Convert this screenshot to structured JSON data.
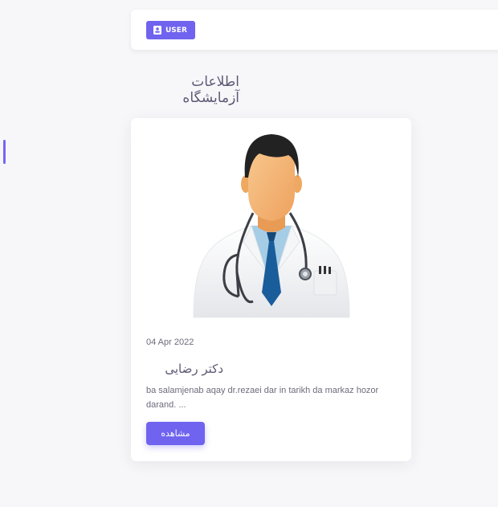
{
  "header": {
    "user_button_label": "USER"
  },
  "section": {
    "title": "اطلاعات آزمایشگاه"
  },
  "card": {
    "date": "04 Apr 2022",
    "title": "دکتر رضایی",
    "text": "ba salamjenab aqay dr.rezaei dar in tarikh da markaz hozor darand. ...",
    "button_label": "مشاهده"
  },
  "colors": {
    "primary": "#6f63ef",
    "background": "#f7f7fa"
  }
}
